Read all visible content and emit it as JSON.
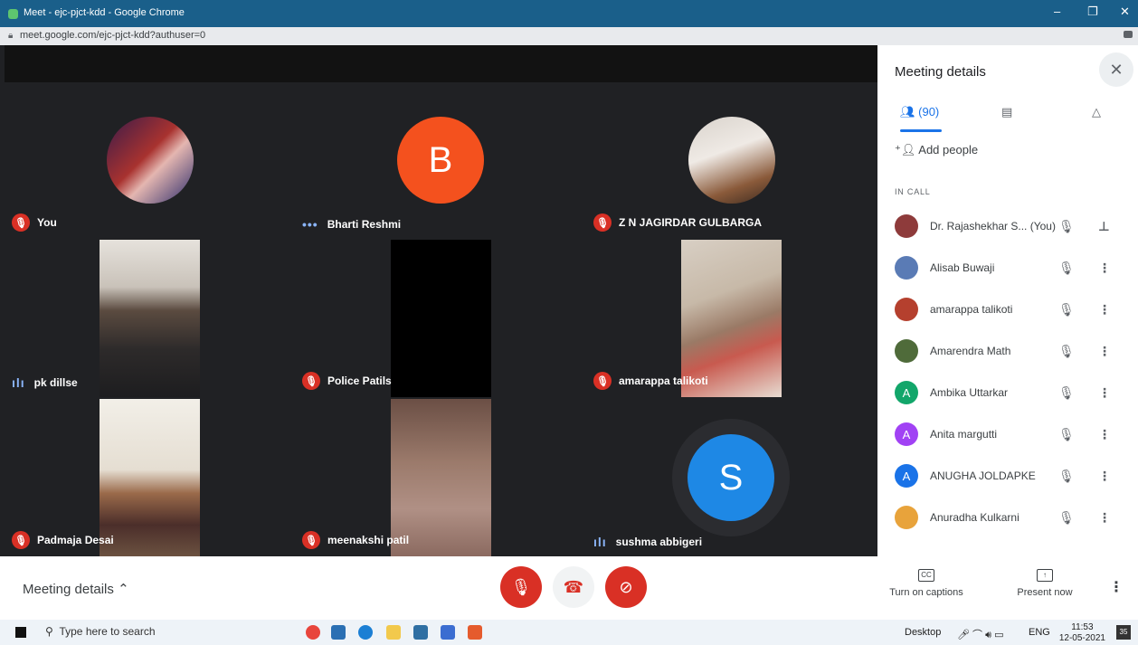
{
  "window": {
    "title": "Meet - ejc-pjct-kdd - Google Chrome",
    "url": "meet.google.com/ejc-pjct-kdd?authuser=0",
    "minimize": "–",
    "restore": "❐",
    "close": "✕"
  },
  "tiles": [
    {
      "name": "You",
      "status": "muted",
      "type": "photo"
    },
    {
      "name": "Bharti Reshmi",
      "status": "dots",
      "type": "initial",
      "initial": "B",
      "color": "#f4511e"
    },
    {
      "name": "Z N JAGIRDAR GULBARGA",
      "status": "muted",
      "type": "photo"
    },
    {
      "name": "pk dillse",
      "status": "speaking",
      "type": "video"
    },
    {
      "name": "Police Patils",
      "status": "muted",
      "type": "video"
    },
    {
      "name": "amarappa talikoti",
      "status": "muted",
      "type": "video"
    },
    {
      "name": "Padmaja Desai",
      "status": "muted",
      "type": "video"
    },
    {
      "name": "meenakshi patil",
      "status": "muted",
      "type": "video"
    },
    {
      "name": "sushma abbigeri",
      "status": "speaking",
      "type": "initial",
      "initial": "S",
      "color": "#1e88e5"
    }
  ],
  "panel": {
    "title": "Meeting details",
    "people_tab": "(90)",
    "add_people": "Add people",
    "in_call": "IN CALL",
    "participants": [
      {
        "name": "Dr. Rajashekhar S...  (You)",
        "avatar": "photo",
        "color": "#8e3b3b",
        "action": "pin"
      },
      {
        "name": "Alisab Buwaji",
        "avatar": "photo",
        "color": "#5a7bb5",
        "action": "more"
      },
      {
        "name": "amarappa talikoti",
        "avatar": "photo",
        "color": "#b5402e",
        "action": "more"
      },
      {
        "name": "Amarendra Math",
        "avatar": "photo",
        "color": "#4f6b3a",
        "action": "more"
      },
      {
        "name": "Ambika Uttarkar",
        "avatar": "A",
        "color": "#12a66a",
        "action": "more"
      },
      {
        "name": "Anita margutti",
        "avatar": "A",
        "color": "#a142f4",
        "action": "more"
      },
      {
        "name": "ANUGHA JOLDAPKE",
        "avatar": "A",
        "color": "#1a73e8",
        "action": "more"
      },
      {
        "name": "Anuradha Kulkarni",
        "avatar": "photo",
        "color": "#e8a33b",
        "action": "more"
      }
    ]
  },
  "bottom": {
    "meeting_details": "Meeting details",
    "captions": "Turn on captions",
    "present": "Present now"
  },
  "taskbar": {
    "search_placeholder": "Type here to search",
    "desktop": "Desktop",
    "lang": "ENG",
    "time": "11:53",
    "date": "12-05-2021",
    "notif_count": "35"
  }
}
